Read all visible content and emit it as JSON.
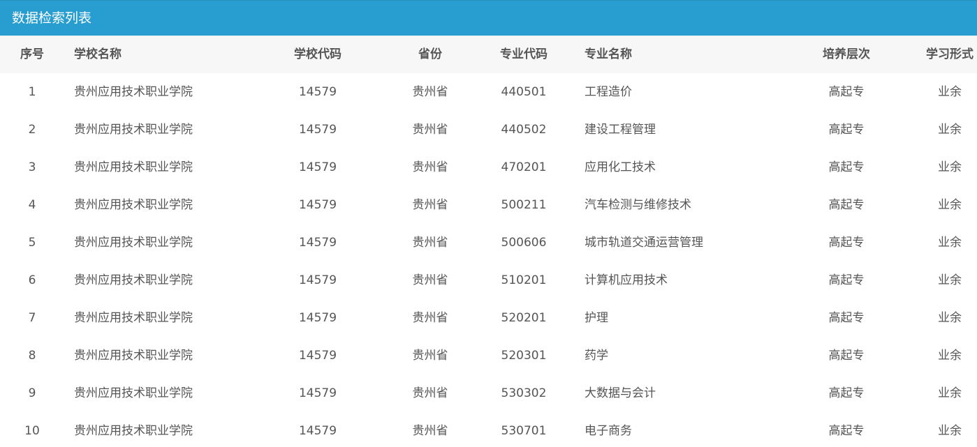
{
  "panel": {
    "title": "数据检索列表"
  },
  "table": {
    "headers": {
      "index": "序号",
      "school_name": "学校名称",
      "school_code": "学校代码",
      "province": "省份",
      "major_code": "专业代码",
      "major_name": "专业名称",
      "level": "培养层次",
      "study_form": "学习形式"
    },
    "rows": [
      {
        "index": "1",
        "school_name": "贵州应用技术职业学院",
        "school_code": "14579",
        "province": "贵州省",
        "major_code": "440501",
        "major_name": "工程造价",
        "level": "高起专",
        "study_form": "业余"
      },
      {
        "index": "2",
        "school_name": "贵州应用技术职业学院",
        "school_code": "14579",
        "province": "贵州省",
        "major_code": "440502",
        "major_name": "建设工程管理",
        "level": "高起专",
        "study_form": "业余"
      },
      {
        "index": "3",
        "school_name": "贵州应用技术职业学院",
        "school_code": "14579",
        "province": "贵州省",
        "major_code": "470201",
        "major_name": "应用化工技术",
        "level": "高起专",
        "study_form": "业余"
      },
      {
        "index": "4",
        "school_name": "贵州应用技术职业学院",
        "school_code": "14579",
        "province": "贵州省",
        "major_code": "500211",
        "major_name": "汽车检测与维修技术",
        "level": "高起专",
        "study_form": "业余"
      },
      {
        "index": "5",
        "school_name": "贵州应用技术职业学院",
        "school_code": "14579",
        "province": "贵州省",
        "major_code": "500606",
        "major_name": "城市轨道交通运营管理",
        "level": "高起专",
        "study_form": "业余"
      },
      {
        "index": "6",
        "school_name": "贵州应用技术职业学院",
        "school_code": "14579",
        "province": "贵州省",
        "major_code": "510201",
        "major_name": "计算机应用技术",
        "level": "高起专",
        "study_form": "业余"
      },
      {
        "index": "7",
        "school_name": "贵州应用技术职业学院",
        "school_code": "14579",
        "province": "贵州省",
        "major_code": "520201",
        "major_name": "护理",
        "level": "高起专",
        "study_form": "业余"
      },
      {
        "index": "8",
        "school_name": "贵州应用技术职业学院",
        "school_code": "14579",
        "province": "贵州省",
        "major_code": "520301",
        "major_name": "药学",
        "level": "高起专",
        "study_form": "业余"
      },
      {
        "index": "9",
        "school_name": "贵州应用技术职业学院",
        "school_code": "14579",
        "province": "贵州省",
        "major_code": "530302",
        "major_name": "大数据与会计",
        "level": "高起专",
        "study_form": "业余"
      },
      {
        "index": "10",
        "school_name": "贵州应用技术职业学院",
        "school_code": "14579",
        "province": "贵州省",
        "major_code": "530701",
        "major_name": "电子商务",
        "level": "高起专",
        "study_form": "业余"
      }
    ]
  }
}
